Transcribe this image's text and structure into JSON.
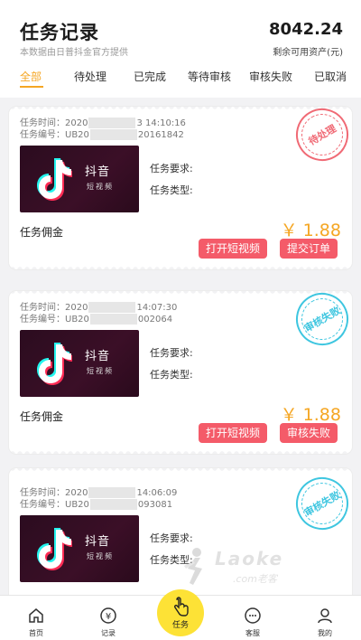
{
  "header": {
    "title": "任务记录",
    "subtitle": "本数据由日普抖金官方提供",
    "balance": "8042.24",
    "balance_label": "剩余可用资产(元)"
  },
  "tabs": [
    {
      "label": "全部",
      "active": true
    },
    {
      "label": "待处理",
      "active": false
    },
    {
      "label": "已完成",
      "active": false
    },
    {
      "label": "等待审核",
      "active": false
    },
    {
      "label": "审核失败",
      "active": false
    },
    {
      "label": "已取消",
      "active": false
    }
  ],
  "cards": [
    {
      "time_prefix": "任务时间：2020",
      "time_suffix": "3 14:10:16",
      "id_prefix": "任务编号：UB20",
      "id_suffix": "20161842",
      "app_name": "抖音",
      "app_sub": "短视频",
      "req_label": "任务要求:",
      "type_label": "任务类型:",
      "commission_label": "任务佣金",
      "price": "￥ 1.88",
      "buttons": [
        "打开短视频",
        "提交订单"
      ],
      "stamp": "待处理",
      "stamp_color": "#f06a75"
    },
    {
      "time_prefix": "任务时间：2020",
      "time_suffix": "14:07:30",
      "id_prefix": "任务编号：UB20",
      "id_suffix": "002064",
      "app_name": "抖音",
      "app_sub": "短视频",
      "req_label": "任务要求:",
      "type_label": "任务类型:",
      "commission_label": "任务佣金",
      "price": "￥ 1.88",
      "buttons": [
        "打开短视频",
        "审核失败"
      ],
      "stamp": "审核失败",
      "stamp_color": "#3ec6e0"
    },
    {
      "time_prefix": "任务时间：2020",
      "time_suffix": "14:06:09",
      "id_prefix": "任务编号：UB20",
      "id_suffix": "093081",
      "app_name": "抖音",
      "app_sub": "短视频",
      "req_label": "任务要求:",
      "type_label": "任务类型:",
      "stamp": "审核失败",
      "stamp_color": "#3ec6e0"
    }
  ],
  "watermark": {
    "text": "Laoke",
    "sub": ".com老客"
  },
  "bottom_nav": [
    {
      "label": "首页",
      "icon": "home-icon"
    },
    {
      "label": "记录",
      "icon": "record-icon"
    },
    {
      "label": "任务",
      "icon": "hand-tap-icon"
    },
    {
      "label": "客服",
      "icon": "chat-icon"
    },
    {
      "label": "我的",
      "icon": "user-icon"
    }
  ],
  "colors": {
    "accent": "#f5a623",
    "button": "#f45b69",
    "center_nav": "#fde236"
  }
}
